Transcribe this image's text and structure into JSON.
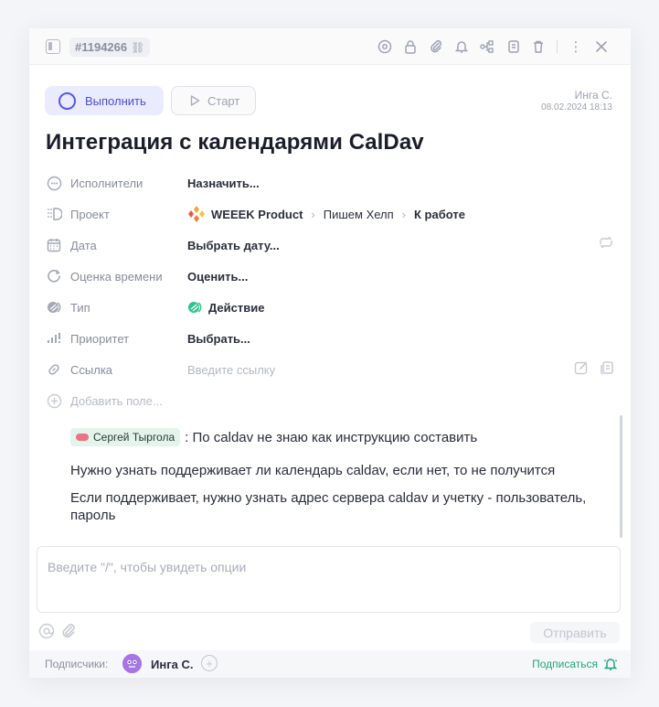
{
  "header": {
    "task_id": "#1194266",
    "icons": [
      "eye-icon",
      "lock-icon",
      "paperclip-icon",
      "bell-icon",
      "subtasks-icon",
      "copy-icon",
      "trash-icon",
      "more-icon",
      "close-icon"
    ]
  },
  "actions": {
    "done_label": "Выполнить",
    "start_label": "Старт"
  },
  "author": {
    "name": "Инга С.",
    "date": "08.02.2024 18:13"
  },
  "task": {
    "title": "Интеграция с календарями CalDav"
  },
  "props": {
    "assignees": {
      "label": "Исполнители",
      "value": "Назначить..."
    },
    "project": {
      "label": "Проект",
      "path": [
        "WEEEK Product",
        "Пишем Хелп",
        "К работе"
      ]
    },
    "date": {
      "label": "Дата",
      "value": "Выбрать дату..."
    },
    "estimate": {
      "label": "Оценка времени",
      "value": "Оценить..."
    },
    "type": {
      "label": "Тип",
      "value": "Действие"
    },
    "priority": {
      "label": "Приоритет",
      "value": "Выбрать..."
    },
    "link": {
      "label": "Ссылка",
      "placeholder": "Введите ссылку"
    },
    "add_field": "Добавить поле..."
  },
  "comment": {
    "mention": "Сергей Тыргола",
    "line1": ": По caldav не знаю как инструкцию составить",
    "line2": "Нужно узнать поддерживает ли календарь caldav, если нет, то не получится",
    "line3": "Если поддерживает, нужно узнать адрес сервера caldav и учетку - пользователь, пароль"
  },
  "composer": {
    "placeholder": "Введите \"/\", чтобы увидеть опции",
    "send_label": "Отправить"
  },
  "footer": {
    "subscribers_label": "Подписчики:",
    "subscriber_name": "Инга С.",
    "subscribe_label": "Подписаться"
  },
  "colors": {
    "accent": "#5358e6",
    "green": "#22a77a",
    "mention_bg": "#e3f4ea"
  }
}
